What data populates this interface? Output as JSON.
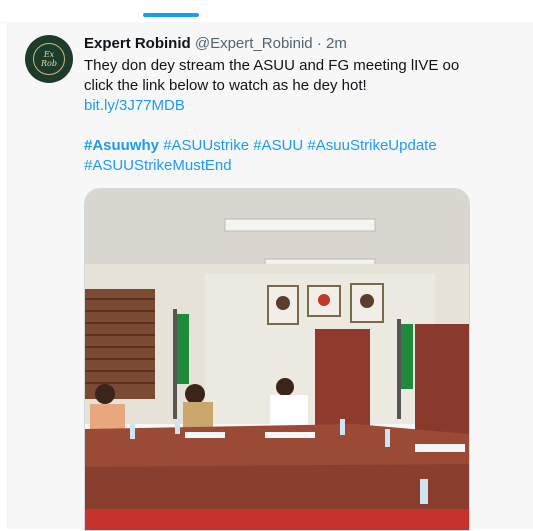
{
  "nav": {
    "active_tab_color": "#1d9bf0"
  },
  "tweet": {
    "avatar_text": "Expert Robinid",
    "display_name": "Expert Robinid",
    "handle": "@Expert_Robinid",
    "separator": "·",
    "time": "2m",
    "text_line1": "They don dey stream the ASUU and FG meeting lIVE oo",
    "text_line2": "click the link below to watch as he dey hot!",
    "link": "bit.ly/3J77MDB",
    "hashtags": [
      "#Asuuwhy",
      "#ASUUstrike",
      "#ASUU",
      "#AsuuStrikeUpdate",
      "#ASUUStrikeMustEnd"
    ],
    "media_description": "meeting room photo"
  }
}
